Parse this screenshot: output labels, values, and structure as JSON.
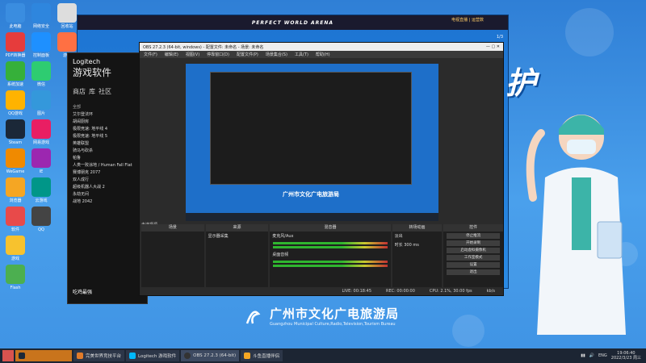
{
  "desktop": {
    "col1": [
      "此电脑",
      "PDF转换器",
      "系统加速",
      "QQ游戏",
      "Steam",
      "WeGame",
      "浏览器",
      "软件",
      "游戏",
      "Flash",
      "打印"
    ],
    "col2": [
      "网络安全",
      "控制面板",
      "",
      "微信",
      "图片",
      "",
      "网易游戏",
      "",
      "IE",
      "云游戏",
      "QQ"
    ],
    "col3": [
      "回收站",
      "游戏",
      "",
      "",
      "",
      "",
      "",
      "",
      "",
      "",
      ""
    ]
  },
  "pwa": {
    "title": "PERFECT WORLD ARENA",
    "user": "电视直播 | 运营数",
    "count": "1/3"
  },
  "logitech": {
    "brand": "Logitech",
    "subtitle": "游戏软件",
    "nav_store": "商店",
    "nav_lib": "库",
    "nav_comm": "社区",
    "section": "全部",
    "games": [
      "艾尔登法环",
      "胡闹厨房",
      "极限竞速: 地平线 4",
      "极限竞速: 地平线 5",
      "英雄联盟",
      "骑马与砍杀",
      "帕鲁",
      "人类一败涂地 / Human Fall Flat",
      "赛博朋克 2077",
      "双人成行",
      "超级机器人大战 2",
      "永劫无间",
      "战地 2042"
    ],
    "footer": "吃鸡最强"
  },
  "obs": {
    "window_title": "OBS 27.2.3 (64-bit, windows) - 配置文件: 未命名 - 场景: 未命名",
    "menu": [
      "文件(F)",
      "编辑(E)",
      "视图(V)",
      "停靠窗口(D)",
      "配置文件(P)",
      "场景集合(S)",
      "工具(T)",
      "帮助(H)"
    ],
    "scene_header": "场景",
    "source_header": "来源",
    "source_item": "显示器采集",
    "mixer_header": "混音器",
    "mixer_ch1": "麦克风/Aux",
    "mixer_ch2": "桌面音频",
    "trans_header": "转场动画",
    "trans_type": "淡出",
    "trans_dur": "300 ms",
    "trans_dur_label": "时长",
    "ctrl_header": "控件",
    "controls": [
      "停止推流",
      "开始录制",
      "启动虚拟摄像机",
      "工作室模式",
      "设置",
      "退出"
    ],
    "status": [
      "LIVE: 00:18:45",
      "REC: 00:00:00",
      "CPU: 2.1%, 30.00 fps",
      "kb/s"
    ],
    "no_scene": "未选择源"
  },
  "banner": {
    "title": "广州市文化广电旅游局",
    "subtitle": "Guangzhou Municipal Culture,Radio,Television,Tourism Bureau",
    "slogan": "护"
  },
  "taskbar": {
    "tasks": [
      {
        "label": "",
        "active": false
      },
      {
        "label": "完美世界竞技平台",
        "active": false
      },
      {
        "label": "Logitech 游戏软件",
        "active": false
      },
      {
        "label": "OBS 27.2.3 (64-bit)",
        "active": true
      },
      {
        "label": "斗鱼直播伴侣",
        "active": false
      }
    ],
    "lang": "ENG",
    "time": "19:06:40",
    "date": "2022/3/23 周三"
  },
  "colors": {
    "accent": "#1e6fc9",
    "taskbar": "#1c2533",
    "obs_bg": "#2b2b2b"
  }
}
